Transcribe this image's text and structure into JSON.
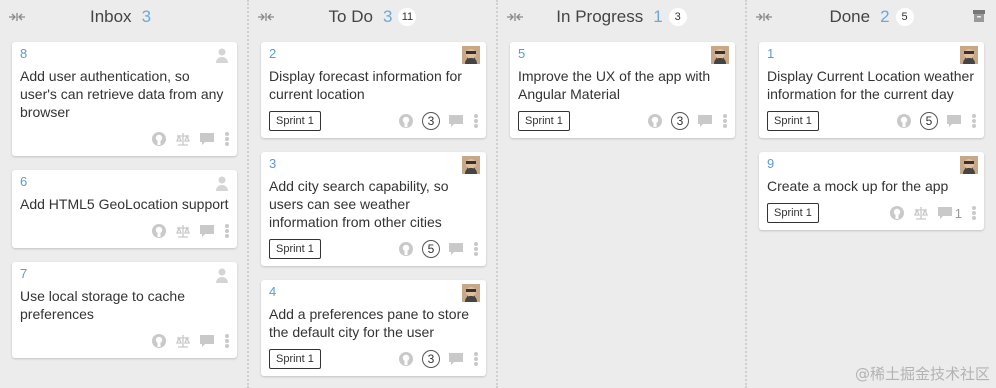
{
  "columns": [
    {
      "title": "Inbox",
      "count": "3",
      "badge": "",
      "cards": [
        {
          "num": "8",
          "title": "Add user authentication, so user's can retrieve data from any browser",
          "sprint": "",
          "points": "",
          "comments": "",
          "assignee": "unassigned"
        },
        {
          "num": "6",
          "title": "Add HTML5 GeoLocation support",
          "sprint": "",
          "points": "",
          "comments": "",
          "assignee": "unassigned"
        },
        {
          "num": "7",
          "title": "Use local storage to cache preferences",
          "sprint": "",
          "points": "",
          "comments": "",
          "assignee": "unassigned"
        }
      ]
    },
    {
      "title": "To Do",
      "count": "3",
      "badge": "11",
      "cards": [
        {
          "num": "2",
          "title": "Display forecast information for current location",
          "sprint": "Sprint 1",
          "points": "3",
          "comments": "",
          "assignee": "avatar"
        },
        {
          "num": "3",
          "title": "Add city search capability, so users can see weather information from other cities",
          "sprint": "Sprint 1",
          "points": "5",
          "comments": "",
          "assignee": "avatar"
        },
        {
          "num": "4",
          "title": "Add a preferences pane to store the default city for the user",
          "sprint": "Sprint 1",
          "points": "3",
          "comments": "",
          "assignee": "avatar"
        }
      ]
    },
    {
      "title": "In Progress",
      "count": "1",
      "badge": "3",
      "cards": [
        {
          "num": "5",
          "title": "Improve the UX of the app with Angular Material",
          "sprint": "Sprint 1",
          "points": "3",
          "comments": "",
          "assignee": "avatar"
        }
      ]
    },
    {
      "title": "Done",
      "count": "2",
      "badge": "5",
      "cards": [
        {
          "num": "1",
          "title": "Display Current Location weather information for the current day",
          "sprint": "Sprint 1",
          "points": "5",
          "comments": "",
          "assignee": "avatar"
        },
        {
          "num": "9",
          "title": "Create a mock up for the app",
          "sprint": "Sprint 1",
          "points": "",
          "comments": "1",
          "assignee": "avatar"
        }
      ]
    }
  ],
  "watermark": "@稀土掘金技术社区",
  "colors": {
    "accent": "#5b9bd5",
    "background": "#ececec",
    "card": "#ffffff"
  }
}
